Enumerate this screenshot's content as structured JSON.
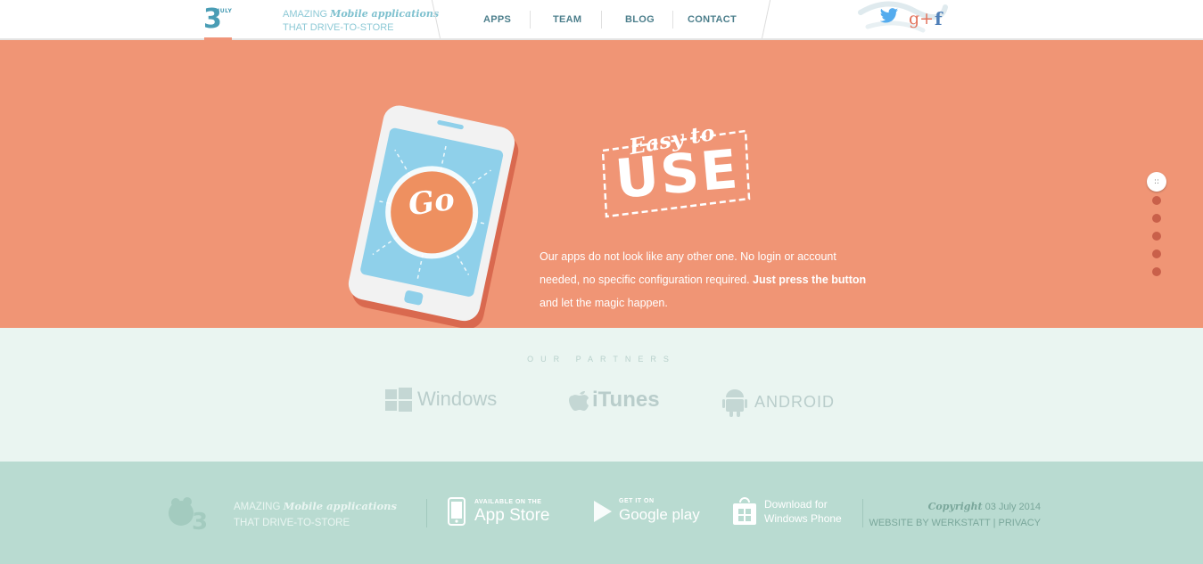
{
  "header": {
    "logo_number": "3",
    "logo_small": "JULY",
    "tagline_prefix": "AMAZING ",
    "tagline_emph": "Mobile applications",
    "tagline_line2": "THAT DRIVE-TO-STORE",
    "nav": [
      {
        "label": "APPS"
      },
      {
        "label": "TEAM"
      },
      {
        "label": "BLOG"
      },
      {
        "label": "CONTACT"
      }
    ],
    "social": [
      {
        "name": "twitter-icon"
      },
      {
        "name": "google-plus-icon",
        "glyph": "g+"
      },
      {
        "name": "facebook-icon",
        "glyph": "f"
      }
    ]
  },
  "hero": {
    "phone_button_label": "Go",
    "badge_script": "Easy to",
    "badge_big": "USE",
    "text_plain_1": "Our apps do not look like any other one. No login or account needed, no specific configuration required. ",
    "text_bold": "Just press the button",
    "text_plain_2": " and let the magic happen.",
    "slide_count": 6,
    "active_slide": 1
  },
  "partners": {
    "title": "OUR PARTNERS",
    "items": [
      {
        "label": "Windows"
      },
      {
        "label": "iTunes"
      },
      {
        "label": "ANDROID"
      }
    ]
  },
  "footer": {
    "tagline_prefix": "AMAZING ",
    "tagline_emph": "Mobile applications",
    "tagline_suffix": " THAT DRIVE-TO-STORE",
    "app_store_small": "AVAILABLE ON THE",
    "app_store_big": "App Store",
    "google_play_small": "GET IT ON",
    "google_play_big": "Google play",
    "windows_phone_line1": "Download for",
    "windows_phone_line2": "Windows Phone",
    "copyright_emph": "Copyright",
    "copyright_date": " 03 July 2014",
    "website_by": "WEBSITE BY WERKSTATT",
    "privacy": "PRIVACY"
  },
  "colors": {
    "hero_bg": "#f09575",
    "partners_bg": "#eaf5f1",
    "footer_bg": "#b9dbd1",
    "accent_blue": "#4a9db5"
  }
}
